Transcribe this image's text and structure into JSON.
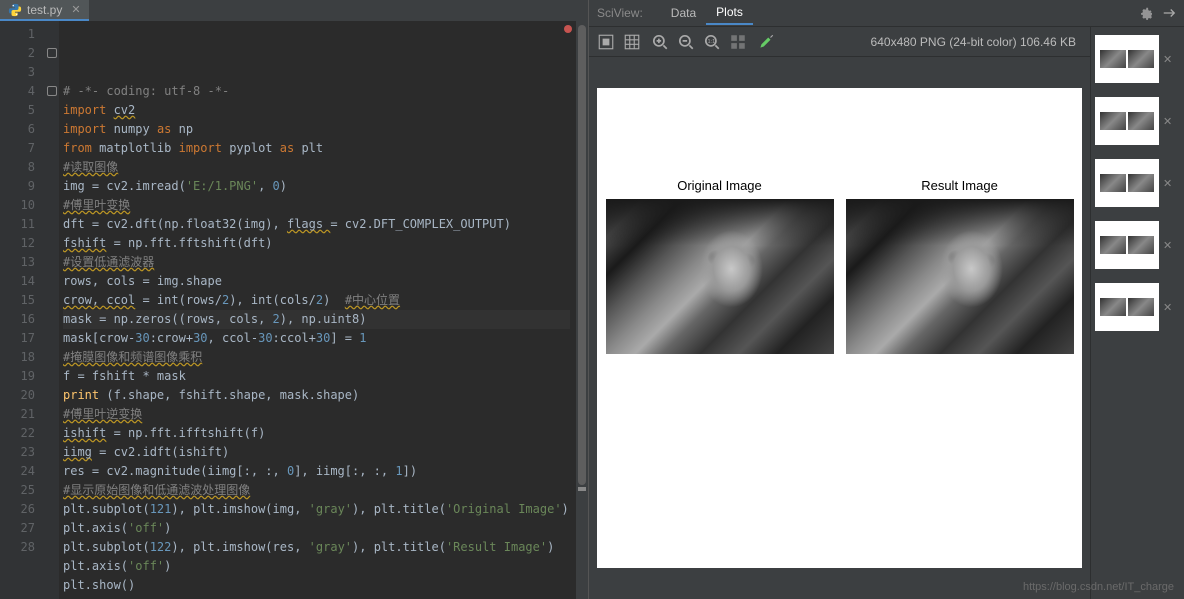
{
  "tabs": {
    "file": "test.py"
  },
  "gutter_lines": 28,
  "markers": [
    1,
    3
  ],
  "code": [
    {
      "n": 1,
      "tokens": [
        {
          "t": "# -*- coding: utf-8 -*-",
          "c": "cmt"
        }
      ]
    },
    {
      "n": 2,
      "tokens": [
        {
          "t": "import ",
          "c": "kw"
        },
        {
          "t": "cv2",
          "c": "warn"
        }
      ]
    },
    {
      "n": 3,
      "tokens": [
        {
          "t": "import ",
          "c": "kw"
        },
        {
          "t": "numpy "
        },
        {
          "t": "as ",
          "c": "kw"
        },
        {
          "t": "np"
        }
      ]
    },
    {
      "n": 4,
      "tokens": [
        {
          "t": "from ",
          "c": "kw"
        },
        {
          "t": "matplotlib "
        },
        {
          "t": "import ",
          "c": "kw"
        },
        {
          "t": "pyplot "
        },
        {
          "t": "as ",
          "c": "kw"
        },
        {
          "t": "plt"
        }
      ]
    },
    {
      "n": 5,
      "tokens": [
        {
          "t": "#读取图像",
          "c": "cmt warn"
        }
      ]
    },
    {
      "n": 6,
      "tokens": [
        {
          "t": "img = cv2.imread("
        },
        {
          "t": "'E:/1.PNG'",
          "c": "str"
        },
        {
          "t": ", "
        },
        {
          "t": "0",
          "c": "num"
        },
        {
          "t": ")"
        }
      ]
    },
    {
      "n": 7,
      "tokens": [
        {
          "t": "#傅里叶变换",
          "c": "cmt warn"
        }
      ]
    },
    {
      "n": 8,
      "tokens": [
        {
          "t": "dft = cv2.dft(np.float32(img), "
        },
        {
          "t": "flags ",
          "c": "warn"
        },
        {
          "t": "= cv2.DFT_COMPLEX_OUTPUT)"
        }
      ]
    },
    {
      "n": 9,
      "tokens": [
        {
          "t": "fshift",
          "c": "warn"
        },
        {
          "t": " = np.fft.fftshift(dft)"
        }
      ]
    },
    {
      "n": 10,
      "tokens": [
        {
          "t": "#设置低通滤波器",
          "c": "cmt warn"
        }
      ]
    },
    {
      "n": 11,
      "tokens": [
        {
          "t": "rows, cols = img.shape"
        }
      ]
    },
    {
      "n": 12,
      "tokens": [
        {
          "t": "crow, ccol",
          "c": "warn"
        },
        {
          "t": " = int(rows/"
        },
        {
          "t": "2",
          "c": "num"
        },
        {
          "t": "), int(cols/"
        },
        {
          "t": "2",
          "c": "num"
        },
        {
          "t": ")  "
        },
        {
          "t": "#中心位置",
          "c": "cmt warn"
        }
      ]
    },
    {
      "n": 13,
      "hl": true,
      "tokens": [
        {
          "t": "mask = np.zeros((rows, cols, "
        },
        {
          "t": "2",
          "c": "num"
        },
        {
          "t": "), np.uint8)"
        }
      ]
    },
    {
      "n": 14,
      "tokens": [
        {
          "t": "mask[crow-"
        },
        {
          "t": "30",
          "c": "num"
        },
        {
          "t": ":crow+"
        },
        {
          "t": "30",
          "c": "num"
        },
        {
          "t": ", ccol-"
        },
        {
          "t": "30",
          "c": "num"
        },
        {
          "t": ":ccol+"
        },
        {
          "t": "30",
          "c": "num"
        },
        {
          "t": "] = "
        },
        {
          "t": "1",
          "c": "num"
        }
      ]
    },
    {
      "n": 15,
      "tokens": [
        {
          "t": "#掩膜图像和频谱图像乘积",
          "c": "cmt warn"
        }
      ]
    },
    {
      "n": 16,
      "tokens": [
        {
          "t": "f = fshift * mask"
        }
      ]
    },
    {
      "n": 17,
      "tokens": [
        {
          "t": "print ",
          "c": "fn"
        },
        {
          "t": "(f.shape, fshift.shape, mask.shape)"
        }
      ]
    },
    {
      "n": 18,
      "tokens": [
        {
          "t": "#傅里叶逆变换",
          "c": "cmt warn"
        }
      ]
    },
    {
      "n": 19,
      "tokens": [
        {
          "t": "ishift",
          "c": "warn"
        },
        {
          "t": " = np.fft.ifftshift(f)"
        }
      ]
    },
    {
      "n": 20,
      "tokens": [
        {
          "t": "iimg",
          "c": "warn"
        },
        {
          "t": " = cv2.idft(ishift)"
        }
      ]
    },
    {
      "n": 21,
      "tokens": [
        {
          "t": "res = cv2.magnitude(iimg[:, :, "
        },
        {
          "t": "0",
          "c": "num"
        },
        {
          "t": "], iimg[:, :, "
        },
        {
          "t": "1",
          "c": "num"
        },
        {
          "t": "])"
        }
      ]
    },
    {
      "n": 22,
      "tokens": [
        {
          "t": "#显示原始图像和低通滤波处理图像",
          "c": "cmt warn"
        }
      ]
    },
    {
      "n": 23,
      "tokens": [
        {
          "t": "plt.subplot("
        },
        {
          "t": "121",
          "c": "num"
        },
        {
          "t": "), plt.imshow(img, "
        },
        {
          "t": "'gray'",
          "c": "str"
        },
        {
          "t": "), plt.title("
        },
        {
          "t": "'Original Image'",
          "c": "str"
        },
        {
          "t": ")"
        }
      ]
    },
    {
      "n": 24,
      "tokens": [
        {
          "t": "plt.axis("
        },
        {
          "t": "'off'",
          "c": "str"
        },
        {
          "t": ")"
        }
      ]
    },
    {
      "n": 25,
      "tokens": [
        {
          "t": "plt.subplot("
        },
        {
          "t": "122",
          "c": "num"
        },
        {
          "t": "), plt.imshow(res, "
        },
        {
          "t": "'gray'",
          "c": "str"
        },
        {
          "t": "), plt.title("
        },
        {
          "t": "'Result Image'",
          "c": "str"
        },
        {
          "t": ")"
        }
      ]
    },
    {
      "n": 26,
      "tokens": [
        {
          "t": "plt.axis("
        },
        {
          "t": "'off'",
          "c": "str"
        },
        {
          "t": ")"
        }
      ]
    },
    {
      "n": 27,
      "tokens": [
        {
          "t": "plt.show()"
        }
      ]
    },
    {
      "n": 28,
      "tokens": [
        {
          "t": ""
        }
      ]
    }
  ],
  "sciview": {
    "label": "SciView:",
    "tabs": {
      "data": "Data",
      "plots": "Plots"
    },
    "info": "640x480 PNG (24-bit color) 106.46 KB",
    "subplot_titles": {
      "left": "Original Image",
      "right": "Result Image"
    },
    "thumb_count": 5
  },
  "watermark": "https://blog.csdn.net/IT_charge"
}
